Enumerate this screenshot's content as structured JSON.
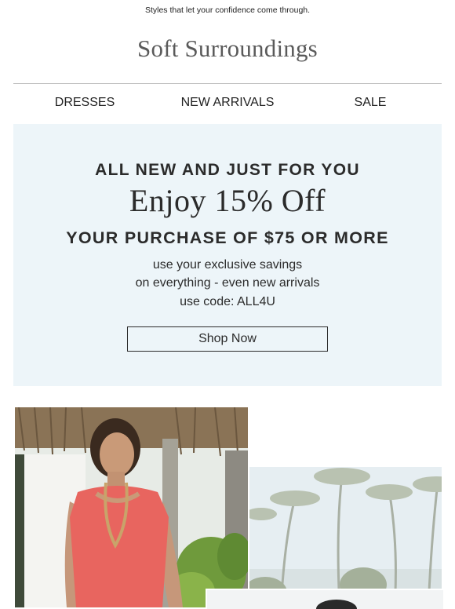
{
  "preheader": "Styles that let your confidence come through.",
  "brand": {
    "logo_text": "Soft Surroundings"
  },
  "nav": {
    "items": [
      {
        "label": "DRESSES"
      },
      {
        "label": "NEW ARRIVALS"
      },
      {
        "label": "SALE"
      }
    ]
  },
  "promo": {
    "kicker": "ALL NEW AND JUST FOR YOU",
    "headline": "Enjoy 15% Off",
    "subhead": "YOUR PURCHASE OF $75 OR MORE",
    "lines": [
      "use your exclusive savings",
      "on everything - even new arrivals",
      "use code: ALL4U"
    ],
    "cta_label": "Shop Now",
    "background_color": "#edf5f9"
  },
  "images": [
    {
      "name": "woman-in-coral-dress-photo"
    },
    {
      "name": "palm-trees-photo"
    },
    {
      "name": "model-photo-partial"
    }
  ]
}
